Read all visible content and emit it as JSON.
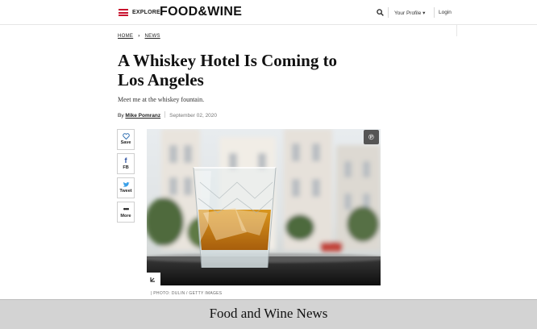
{
  "header": {
    "explore_label": "EXPLORE",
    "brand": "FOOD&WINE",
    "profile_label": "Your Profile ▾",
    "login_label": "Login",
    "icons": {
      "menu": "hamburger-icon",
      "search": "search-icon"
    },
    "accent_color": "#c8102e"
  },
  "breadcrumb": {
    "home": "HOME",
    "section": "NEWS"
  },
  "article": {
    "headline_line1": "A Whiskey Hotel Is Coming to",
    "headline_line2": "Los Angeles",
    "dek": "Meet me at the whiskey fountain.",
    "by": "By",
    "author": "Mike Pomranz",
    "date": "September 02, 2020"
  },
  "social": [
    {
      "label": "Save",
      "icon": "heart-icon"
    },
    {
      "label": "FB",
      "icon": "facebook-icon"
    },
    {
      "label": "Tweet",
      "icon": "twitter-icon"
    },
    {
      "label": "More",
      "icon": "more-icon"
    }
  ],
  "image": {
    "pin_icon": "pinterest-icon",
    "expand_icon": "expand-icon",
    "credit": "| PHOTO: DULIN / GETTY IMAGES"
  },
  "caption_band": {
    "text": "Food and Wine News"
  }
}
